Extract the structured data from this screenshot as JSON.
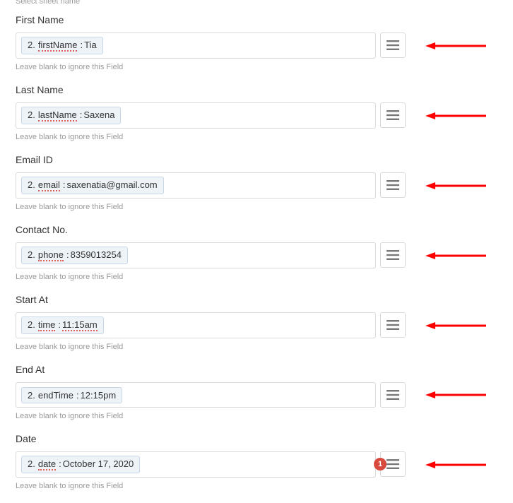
{
  "helper_top": "Select sheet name",
  "helper_text": "Leave blank to ignore this Field",
  "badge_count": "1",
  "fields": [
    {
      "label": "First Name",
      "prefix": "2.",
      "key": "firstName",
      "value": "Tia",
      "keyUnderline": true,
      "valUnderline": false,
      "badge": false
    },
    {
      "label": "Last Name",
      "prefix": "2.",
      "key": "lastName",
      "value": "Saxena",
      "keyUnderline": true,
      "valUnderline": false,
      "badge": false
    },
    {
      "label": "Email ID",
      "prefix": "2.",
      "key": "email ",
      "value": "saxenatia@gmail.com",
      "keyUnderline": true,
      "valUnderline": false,
      "badge": false
    },
    {
      "label": "Contact No.",
      "prefix": "2.",
      "key": "phone ",
      "value": "8359013254",
      "keyUnderline": true,
      "valUnderline": false,
      "badge": false
    },
    {
      "label": "Start At",
      "prefix": "2.",
      "key": "time ",
      "value": "11:15am",
      "keyUnderline": true,
      "valUnderline": true,
      "badge": false
    },
    {
      "label": "End At",
      "prefix": "2.",
      "key": "endTime",
      "value": "12:15pm",
      "keyUnderline": false,
      "valUnderline": false,
      "badge": false
    },
    {
      "label": "Date",
      "prefix": "2.",
      "key": "date ",
      "value": "October 17, 2020",
      "keyUnderline": true,
      "valUnderline": false,
      "badge": true
    }
  ]
}
